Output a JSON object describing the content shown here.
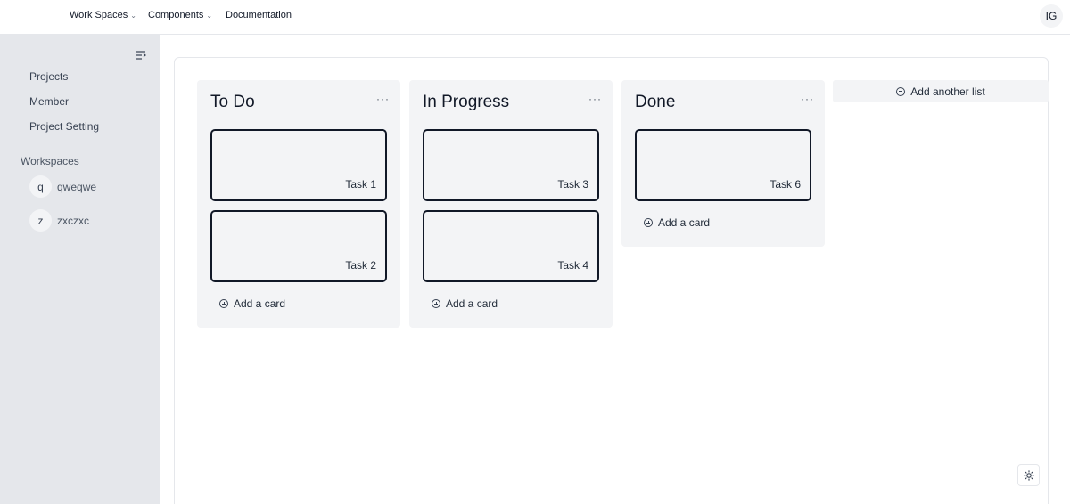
{
  "nav": {
    "items": [
      {
        "label": "Work Spaces",
        "has_dropdown": true
      },
      {
        "label": "Components",
        "has_dropdown": true
      },
      {
        "label": "Documentation",
        "has_dropdown": false
      }
    ],
    "user_initials": "IG"
  },
  "sidebar": {
    "toggle_icon": "sidebar-collapse-icon",
    "links": [
      {
        "label": "Projects"
      },
      {
        "label": "Member"
      },
      {
        "label": "Project Setting"
      }
    ],
    "workspaces_heading": "Workspaces",
    "workspaces": [
      {
        "initial": "q",
        "name": "qweqwe"
      },
      {
        "initial": "z",
        "name": "zxczxc"
      }
    ]
  },
  "board": {
    "lists": [
      {
        "title": "To Do",
        "cards": [
          "Task 1",
          "Task 2"
        ],
        "add_card_label": "Add a card"
      },
      {
        "title": "In Progress",
        "cards": [
          "Task 3",
          "Task 4"
        ],
        "add_card_label": "Add a card"
      },
      {
        "title": "Done",
        "cards": [
          "Task 6"
        ],
        "add_card_label": "Add a card"
      }
    ],
    "list_menu_glyph": "···",
    "add_list_label": "Add another list"
  },
  "theme_toggle_icon": "sun-icon",
  "colors": {
    "sidebar_bg": "#e5e7eb",
    "list_bg": "#f3f4f6",
    "card_border": "#111827"
  }
}
